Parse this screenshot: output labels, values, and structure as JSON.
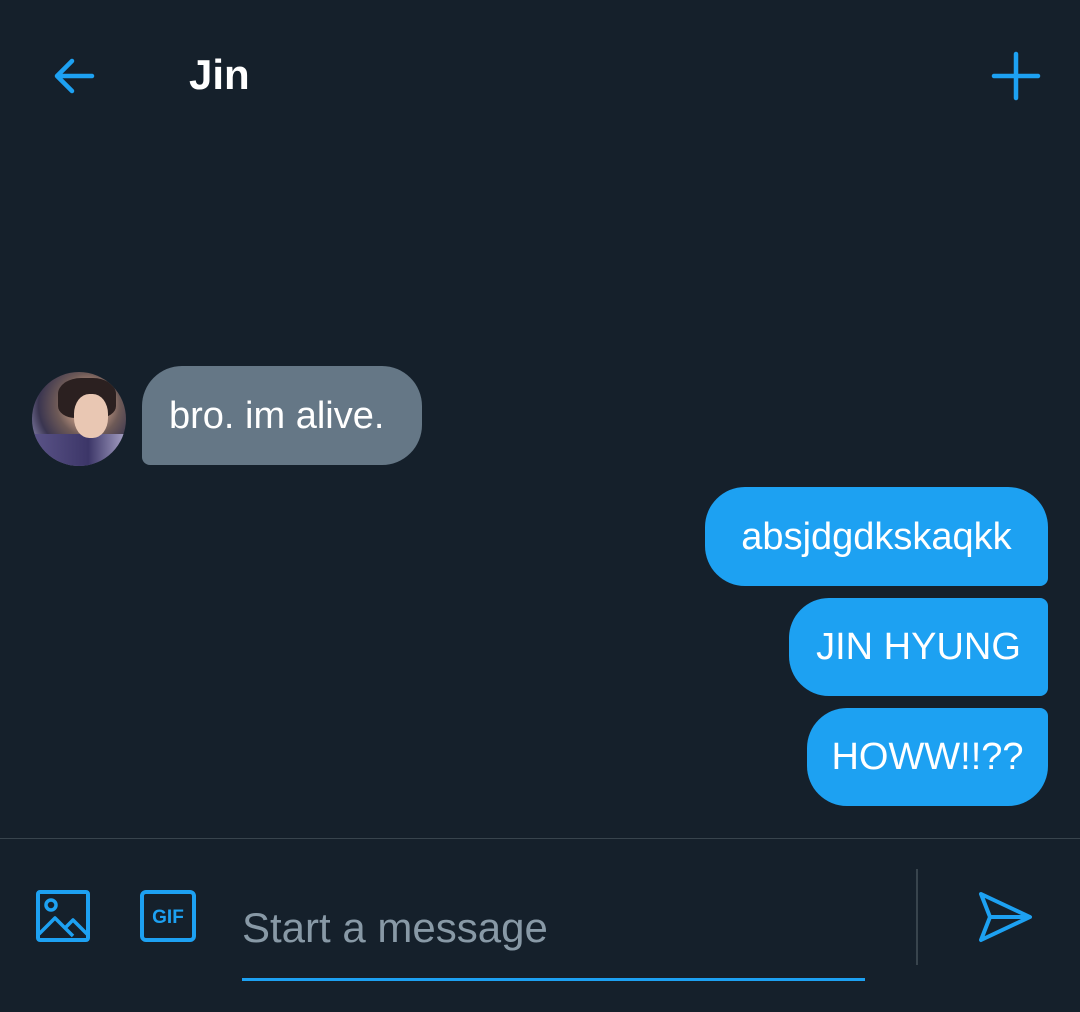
{
  "header": {
    "title": "Jin",
    "back_icon": "arrow-left-icon",
    "add_icon": "plus-icon"
  },
  "conversation": {
    "incoming": [
      {
        "text": "bro. im alive."
      }
    ],
    "outgoing": [
      {
        "text": "absjdgdkskaqkk"
      },
      {
        "text": "JIN HYUNG"
      },
      {
        "text": "HOWW!!??"
      }
    ]
  },
  "composer": {
    "placeholder": "Start a message",
    "value": "",
    "media_icon": "image-icon",
    "gif_label": "GIF",
    "send_icon": "send-icon"
  },
  "colors": {
    "background": "#15202b",
    "accent": "#1da1f2",
    "incoming_bubble": "#657786",
    "placeholder": "#8899a6",
    "divider": "#38444d"
  }
}
